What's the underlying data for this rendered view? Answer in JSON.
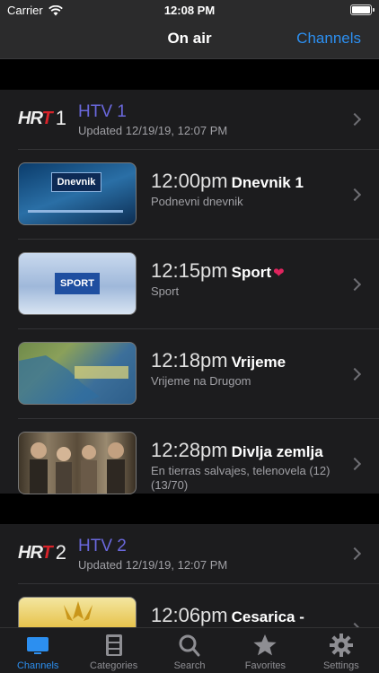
{
  "status": {
    "carrier": "Carrier",
    "time": "12:08 PM"
  },
  "nav": {
    "title": "On air",
    "action": "Channels"
  },
  "channels": [
    {
      "number": "1",
      "name": "HTV 1",
      "updated": "Updated 12/19/19, 12:07 PM",
      "programs": [
        {
          "time": "12:00pm",
          "title": "Dnevnik 1",
          "subtitle": "Podnevni dnevnik",
          "thumb_caption": "Dnevnik"
        },
        {
          "time": "12:15pm",
          "title": "Sport",
          "subtitle": "Sport",
          "thumb_caption": "SPORT"
        },
        {
          "time": "12:18pm",
          "title": "Vrijeme",
          "subtitle": "Vrijeme na Drugom"
        },
        {
          "time": "12:28pm",
          "title": "Divlja zemlja",
          "subtitle": "En tierras salvajes, telenovela (12) (13/70)"
        }
      ]
    },
    {
      "number": "2",
      "name": "HTV 2",
      "updated": "Updated 12/19/19, 12:07 PM",
      "programs": [
        {
          "time": "12:06pm",
          "title": "Cesarica -",
          "subtitle": ""
        }
      ]
    }
  ],
  "tabs": [
    {
      "label": "Channels",
      "icon": "tv-icon"
    },
    {
      "label": "Categories",
      "icon": "cabinet-icon"
    },
    {
      "label": "Search",
      "icon": "search-icon"
    },
    {
      "label": "Favorites",
      "icon": "star-icon"
    },
    {
      "label": "Settings",
      "icon": "gear-icon"
    }
  ],
  "colors": {
    "accent": "#2c8ff0",
    "channel_name": "#6a68dc",
    "hrt_red": "#d8232a"
  }
}
